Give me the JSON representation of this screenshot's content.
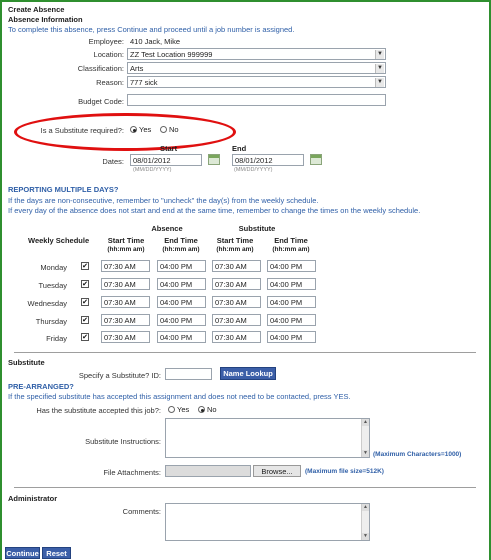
{
  "page_title": "Create Absence",
  "absence_info": {
    "heading": "Absence Information",
    "instructions": "To complete this absence, press Continue and proceed until a job number is assigned.",
    "employee_label": "Employee:",
    "employee_value": "410 Jack, Mike",
    "location_label": "Location:",
    "location_value": "ZZ Test Location 999999",
    "classification_label": "Classification:",
    "classification_value": "Arts",
    "reason_label": "Reason:",
    "reason_value": "777 sick",
    "budget_label": "Budget Code:",
    "budget_value": "",
    "sub_required_label": "Is a Substitute required?:",
    "sub_required_yes": "Yes",
    "sub_required_no": "No",
    "sub_required_selected": "Yes",
    "start_label": "Start",
    "end_label": "End",
    "dates_label": "Dates:",
    "start_date": "08/01/2012",
    "end_date": "08/01/2012",
    "date_hint": "(MM/DD/YYYY)"
  },
  "multiple_days": {
    "heading": "REPORTING MULTIPLE DAYS?",
    "line1": "If the days are non-consecutive, remember to \"uncheck\" the day(s) from the weekly schedule.",
    "line2": "If every day of the absence does not start and end at the same time, remember to change the times on the weekly schedule."
  },
  "schedule": {
    "group_absence": "Absence",
    "group_substitute": "Substitute",
    "col_weekly": "Weekly Schedule",
    "col_start": "Start Time",
    "col_end": "End Time",
    "time_hint": "(hh:mm am)",
    "rows": [
      {
        "day": "Monday",
        "checked": true,
        "abs_start": "07:30 AM",
        "abs_end": "04:00 PM",
        "sub_start": "07:30 AM",
        "sub_end": "04:00 PM"
      },
      {
        "day": "Tuesday",
        "checked": true,
        "abs_start": "07:30 AM",
        "abs_end": "04:00 PM",
        "sub_start": "07:30 AM",
        "sub_end": "04:00 PM"
      },
      {
        "day": "Wednesday",
        "checked": true,
        "abs_start": "07:30 AM",
        "abs_end": "04:00 PM",
        "sub_start": "07:30 AM",
        "sub_end": "04:00 PM"
      },
      {
        "day": "Thursday",
        "checked": true,
        "abs_start": "07:30 AM",
        "abs_end": "04:00 PM",
        "sub_start": "07:30 AM",
        "sub_end": "04:00 PM"
      },
      {
        "day": "Friday",
        "checked": true,
        "abs_start": "07:30 AM",
        "abs_end": "04:00 PM",
        "sub_start": "07:30 AM",
        "sub_end": "04:00 PM"
      }
    ]
  },
  "substitute": {
    "heading": "Substitute",
    "specify_label": "Specify a Substitute? ID:",
    "specify_value": "",
    "lookup_button": "Name Lookup",
    "prearranged_heading": "PRE-ARRANGED?",
    "prearranged_text": "If the specified substitute has accepted this assignment and does not need to be contacted, press YES.",
    "accepted_label": "Has the substitute accepted this job?:",
    "accepted_yes": "Yes",
    "accepted_no": "No",
    "accepted_selected": "No",
    "instructions_label": "Substitute Instructions:",
    "instructions_note": "(Maximum Characters=1000)",
    "attachments_label": "File Attachments:",
    "browse_button": "Browse...",
    "attachments_note": "(Maximum file size=512K)"
  },
  "administrator": {
    "heading": "Administrator",
    "comments_label": "Comments:"
  },
  "footer": {
    "continue_button": "Continue",
    "reset_button": "Reset"
  },
  "colors": {
    "frame_border": "#2f8f2f",
    "highlight_ellipse": "#e01010",
    "link_blue": "#2f5fa7",
    "button_blue": "#3c5fa8"
  }
}
